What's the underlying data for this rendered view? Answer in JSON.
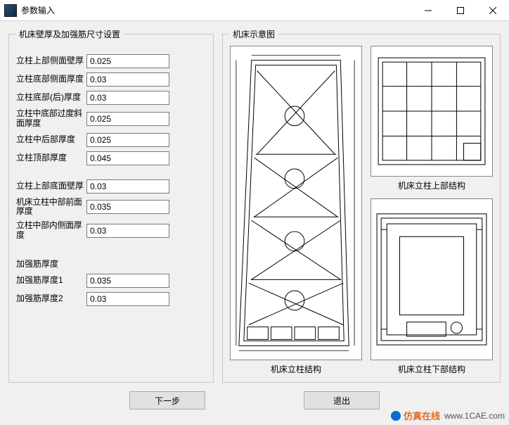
{
  "window": {
    "title": "参数输入"
  },
  "fieldset_left": {
    "legend": "机床壁厚及加强筋尺寸设置"
  },
  "fieldset_right": {
    "legend": "机床示意图"
  },
  "params": {
    "f1_label": "立柱上部侧面壁厚",
    "f1_value": "0.025",
    "f2_label": "立柱底部侧面厚度",
    "f2_value": "0.03",
    "f3_label": "立柱底部(后)厚度",
    "f3_value": "0.03",
    "f4_label": "立柱中底部过度斜面厚度",
    "f4_value": "0.025",
    "f5_label": "立柱中后部厚度",
    "f5_value": "0.025",
    "f6_label": "立柱顶部厚度",
    "f6_value": "0.045",
    "f7_label": "立柱上部底面壁厚",
    "f7_value": "0.03",
    "f8_label": "机床立柱中部前面厚度",
    "f8_value": "0.035",
    "f9_label": "立柱中部内侧面厚度",
    "f9_value": "0.03"
  },
  "rib": {
    "title": "加强筋厚度",
    "r1_label": "加强筋厚度1",
    "r1_value": "0.035",
    "r2_label": "加强筋厚度2",
    "r2_value": "0.03"
  },
  "diagrams": {
    "caption_main": "机床立柱结构",
    "caption_top": "机床立柱上部结构",
    "caption_bottom": "机床立柱下部结构"
  },
  "buttons": {
    "next": "下一步",
    "exit": "退出"
  },
  "watermark": {
    "brand": "仿真在线",
    "url": "www.1CAE.com"
  }
}
